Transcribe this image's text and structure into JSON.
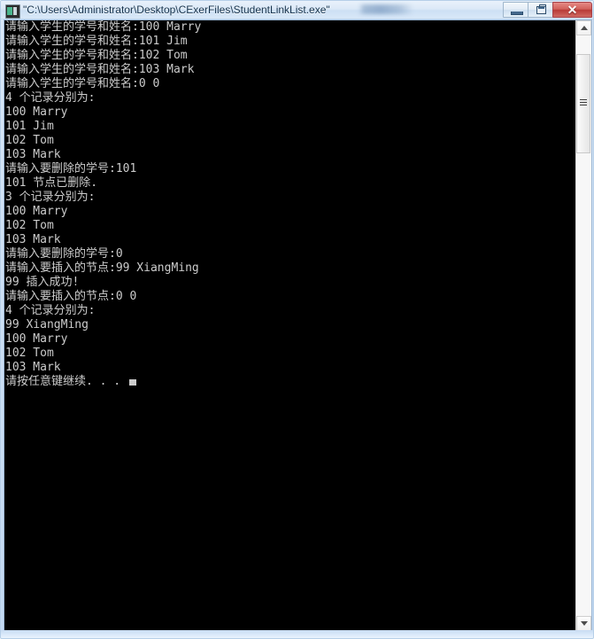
{
  "window": {
    "title": "\"C:\\Users\\Administrator\\Desktop\\CExerFiles\\StudentLinkList.exe\"",
    "icon_name": "console-app-icon",
    "has_redacted_title_region": true
  },
  "caption": {
    "minimize_label": "",
    "restore_label": "",
    "close_label": "✕",
    "close_color": "#b93b37"
  },
  "console": {
    "background_color": "#000000",
    "text_color": "#cccccc",
    "cursor": "block",
    "lines": [
      "请输入学生的学号和姓名:100 Marry",
      "请输入学生的学号和姓名:101 Jim",
      "请输入学生的学号和姓名:102 Tom",
      "请输入学生的学号和姓名:103 Mark",
      "请输入学生的学号和姓名:0 0",
      "4 个记录分别为:",
      "100 Marry",
      "101 Jim",
      "102 Tom",
      "103 Mark",
      "请输入要删除的学号:101",
      "101 节点已删除.",
      "3 个记录分别为:",
      "100 Marry",
      "102 Tom",
      "103 Mark",
      "请输入要删除的学号:0",
      "请输入要插入的节点:99 XiangMing",
      "99 插入成功!",
      "请输入要插入的节点:0 0",
      "4 个记录分别为:",
      "99 XiangMing",
      "100 Marry",
      "102 Tom",
      "103 Mark"
    ],
    "last_line": "请按任意键继续. . . "
  },
  "scrollbar": {
    "up_arrow_icon": "triangle-up-icon",
    "down_arrow_icon": "triangle-down-icon",
    "orientation": "vertical"
  }
}
